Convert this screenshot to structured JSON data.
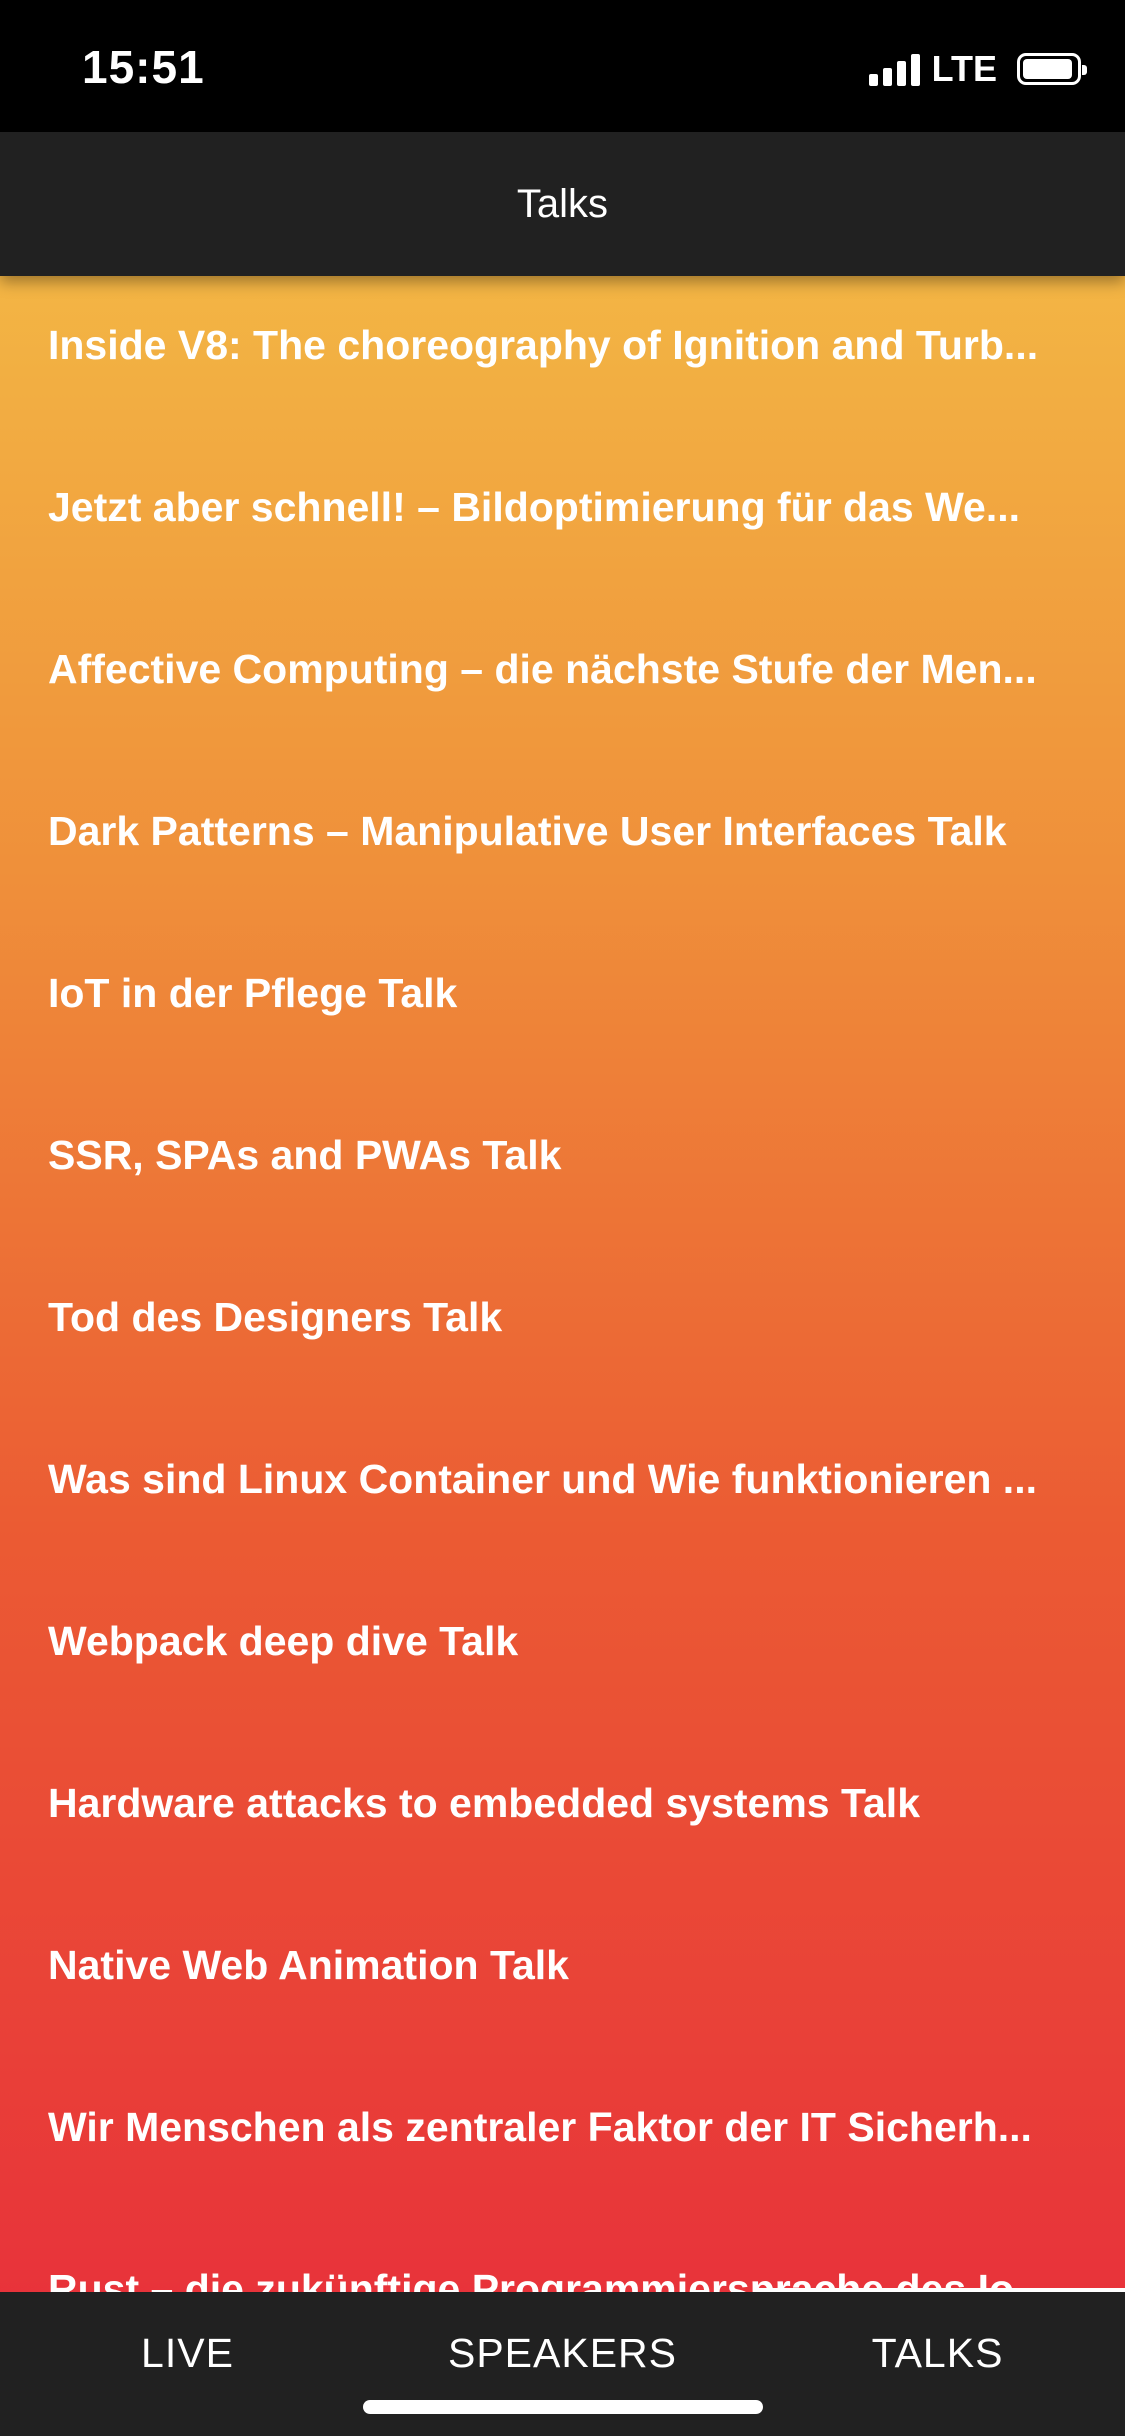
{
  "status_bar": {
    "time": "15:51",
    "network": "LTE",
    "battery_level": 0.95
  },
  "header": {
    "title": "Talks"
  },
  "talks": [
    {
      "label": "Inside V8: The choreography of Ignition and Turb..."
    },
    {
      "label": "Jetzt aber schnell! – Bildoptimierung für das We..."
    },
    {
      "label": "Affective Computing – die nächste Stufe der Men..."
    },
    {
      "label": "Dark Patterns – Manipulative User Interfaces Talk"
    },
    {
      "label": "IoT in der Pflege Talk"
    },
    {
      "label": "SSR, SPAs and PWAs Talk"
    },
    {
      "label": "Tod des Designers Talk"
    },
    {
      "label": "Was sind Linux Container und Wie funktionieren ..."
    },
    {
      "label": "Webpack deep dive Talk"
    },
    {
      "label": "Hardware attacks to embedded systems Talk"
    },
    {
      "label": "Native Web Animation Talk"
    },
    {
      "label": "Wir Menschen als zentraler Faktor der IT Sicherh..."
    },
    {
      "label": "Rust – die zukünftige Programmiersprache des Io..."
    }
  ],
  "tabs": [
    {
      "label": "LIVE"
    },
    {
      "label": "SPEAKERS"
    },
    {
      "label": "TALKS"
    }
  ],
  "colors": {
    "gradient_top": "#f3b544",
    "gradient_bottom": "#e8333a",
    "bar_background": "#212121"
  }
}
